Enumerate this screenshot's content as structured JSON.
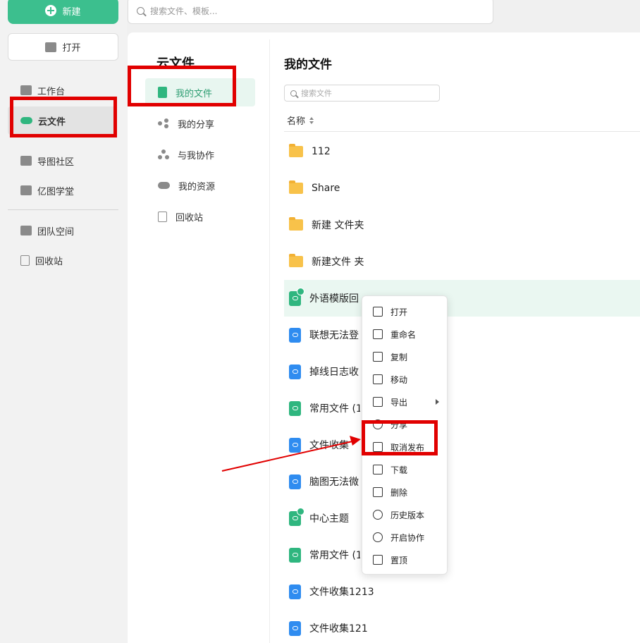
{
  "sidebar": {
    "new_button": "新建",
    "open_button": "打开",
    "items": [
      {
        "label": "工作台"
      },
      {
        "label": "云文件"
      },
      {
        "label": "导图社区"
      },
      {
        "label": "亿图学堂"
      },
      {
        "label": "团队空间"
      },
      {
        "label": "回收站"
      }
    ]
  },
  "topbar": {
    "search_placeholder": "搜索文件、模板..."
  },
  "cloud": {
    "title": "云文件",
    "nav": [
      {
        "label": "我的文件"
      },
      {
        "label": "我的分享"
      },
      {
        "label": "与我协作"
      },
      {
        "label": "我的资源"
      },
      {
        "label": "回收站"
      }
    ]
  },
  "files": {
    "title": "我的文件",
    "search_placeholder": "搜索文件",
    "column_name": "名称",
    "rows": [
      {
        "name": "112",
        "icon": "folder-icon"
      },
      {
        "name": "Share",
        "icon": "folder-icon"
      },
      {
        "name": "新建 文件夹",
        "icon": "folder-icon"
      },
      {
        "name": "新建文件 夹",
        "icon": "folder-icon"
      },
      {
        "name": "外语模版回",
        "icon": "published-mindmap-icon"
      },
      {
        "name": "联想无法登",
        "icon": "mindmap-file-icon"
      },
      {
        "name": "掉线日志收",
        "icon": "mindmap-file-icon"
      },
      {
        "name": "常用文件 (1",
        "icon": "cloud-file-icon"
      },
      {
        "name": "文件收集",
        "icon": "mindmap-file-icon"
      },
      {
        "name": "脑图无法微",
        "icon": "mindmap-file-icon"
      },
      {
        "name": "中心主题",
        "icon": "published-mindmap-icon"
      },
      {
        "name": "常用文件 (1",
        "icon": "cloud-file-icon"
      },
      {
        "name": "文件收集1213",
        "icon": "mindmap-file-icon"
      },
      {
        "name": "文件收集121",
        "icon": "mindmap-file-icon"
      }
    ]
  },
  "context_menu": {
    "items": [
      {
        "label": "打开",
        "icon": "open-icon"
      },
      {
        "label": "重命名",
        "icon": "rename-icon"
      },
      {
        "label": "复制",
        "icon": "copy-icon"
      },
      {
        "label": "移动",
        "icon": "move-icon"
      },
      {
        "label": "导出",
        "icon": "export-icon"
      },
      {
        "label": "分享",
        "icon": "share-icon"
      },
      {
        "label": "取消发布",
        "icon": "unpublish-icon"
      },
      {
        "label": "下载",
        "icon": "download-icon"
      },
      {
        "label": "删除",
        "icon": "delete-icon"
      },
      {
        "label": "历史版本",
        "icon": "history-icon"
      },
      {
        "label": "开启协作",
        "icon": "collaborate-icon"
      },
      {
        "label": "置顶",
        "icon": "pin-top-icon"
      }
    ]
  },
  "colors": {
    "brand_green": "#3cbf8e",
    "annotation_red": "#e10000",
    "file_blue": "#2f8cf0"
  }
}
